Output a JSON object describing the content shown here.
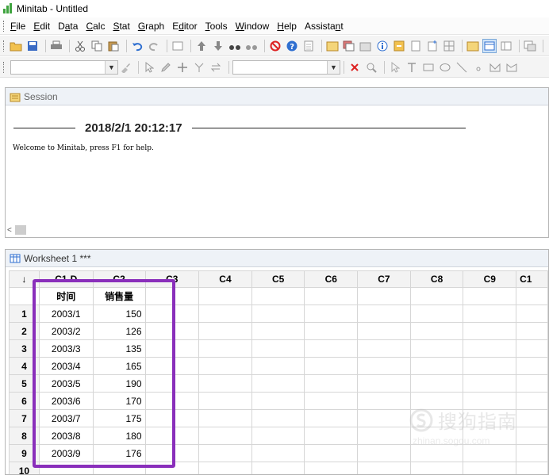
{
  "window": {
    "title": "Minitab - Untitled"
  },
  "menu": [
    {
      "pre": "",
      "u": "F",
      "post": "ile"
    },
    {
      "pre": "",
      "u": "E",
      "post": "dit"
    },
    {
      "pre": "D",
      "u": "a",
      "post": "ta"
    },
    {
      "pre": "",
      "u": "C",
      "post": "alc"
    },
    {
      "pre": "",
      "u": "S",
      "post": "tat"
    },
    {
      "pre": "",
      "u": "G",
      "post": "raph"
    },
    {
      "pre": "E",
      "u": "d",
      "post": "itor"
    },
    {
      "pre": "",
      "u": "T",
      "post": "ools"
    },
    {
      "pre": "",
      "u": "W",
      "post": "indow"
    },
    {
      "pre": "",
      "u": "H",
      "post": "elp"
    },
    {
      "pre": "Assista",
      "u": "n",
      "post": "t"
    }
  ],
  "session": {
    "title": "Session",
    "datetime": "2018/2/1 20:12:17",
    "welcome": "Welcome to Minitab, press F1 for help."
  },
  "worksheet": {
    "title": "Worksheet 1 ***",
    "corner_symbol": "↓",
    "columns": [
      "C1-D",
      "C2",
      "C3",
      "C4",
      "C5",
      "C6",
      "C7",
      "C8",
      "C9",
      "C1"
    ],
    "names": [
      "时间",
      "销售量",
      "",
      "",
      "",
      "",
      "",
      "",
      "",
      ""
    ],
    "rows": [
      {
        "num": "1",
        "c1": "2003/1",
        "c2": "150"
      },
      {
        "num": "2",
        "c1": "2003/2",
        "c2": "126"
      },
      {
        "num": "3",
        "c1": "2003/3",
        "c2": "135"
      },
      {
        "num": "4",
        "c1": "2003/4",
        "c2": "165"
      },
      {
        "num": "5",
        "c1": "2003/5",
        "c2": "190"
      },
      {
        "num": "6",
        "c1": "2003/6",
        "c2": "170"
      },
      {
        "num": "7",
        "c1": "2003/7",
        "c2": "175"
      },
      {
        "num": "8",
        "c1": "2003/8",
        "c2": "180"
      },
      {
        "num": "9",
        "c1": "2003/9",
        "c2": "176"
      },
      {
        "num": "10",
        "c1": "",
        "c2": ""
      }
    ]
  },
  "highlight_color": "#8a2fbb",
  "watermark": {
    "text": "搜狗指南",
    "sub": "zhinan.sogou.com"
  }
}
